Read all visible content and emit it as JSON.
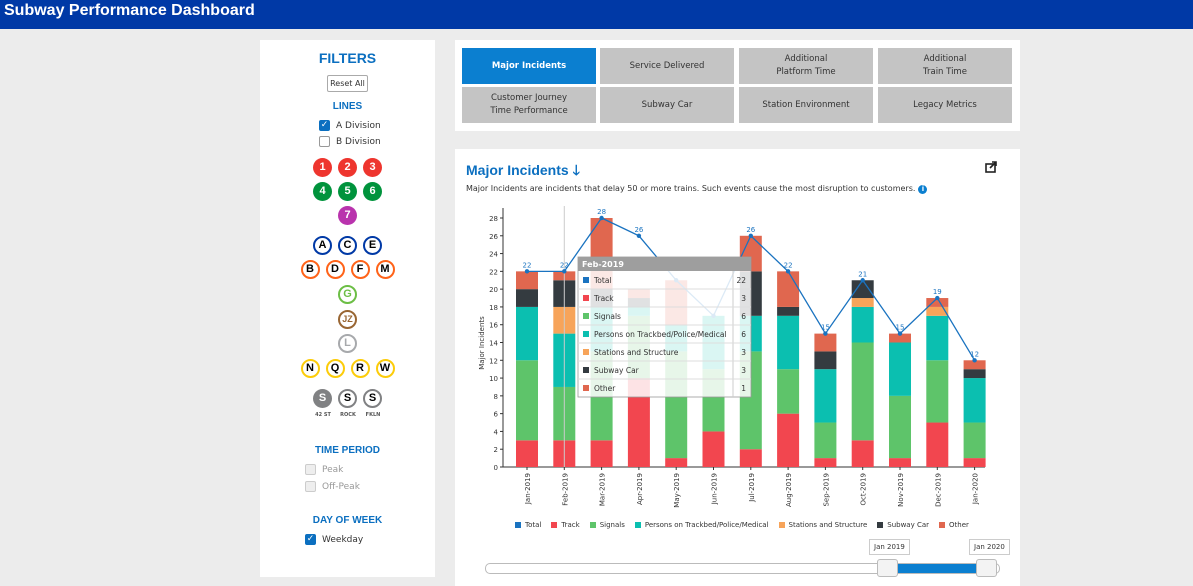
{
  "app": {
    "title": "Subway Performance Dashboard"
  },
  "filters": {
    "title": "FILTERS",
    "reset_label": "Reset All",
    "lines_title": "LINES",
    "divisions": [
      {
        "label": "A Division",
        "checked": true
      },
      {
        "label": "B Division",
        "checked": false
      }
    ],
    "routes": [
      {
        "label": "1",
        "color": "#ee352e",
        "style": "fill"
      },
      {
        "label": "2",
        "color": "#ee352e",
        "style": "fill"
      },
      {
        "label": "3",
        "color": "#ee352e",
        "style": "fill"
      },
      {
        "label": "4",
        "color": "#00933c",
        "style": "fill"
      },
      {
        "label": "5",
        "color": "#00933c",
        "style": "fill"
      },
      {
        "label": "6",
        "color": "#00933c",
        "style": "fill"
      },
      {
        "label": "7",
        "color": "#b933ad",
        "style": "fill"
      },
      {
        "label": "A",
        "color": "#0039a6",
        "style": "ring"
      },
      {
        "label": "C",
        "color": "#0039a6",
        "style": "ring"
      },
      {
        "label": "E",
        "color": "#0039a6",
        "style": "ring"
      },
      {
        "label": "B",
        "color": "#ff6319",
        "style": "ring"
      },
      {
        "label": "D",
        "color": "#ff6319",
        "style": "ring"
      },
      {
        "label": "F",
        "color": "#ff6319",
        "style": "ring"
      },
      {
        "label": "M",
        "color": "#ff6319",
        "style": "ring"
      },
      {
        "label": "G",
        "color": "#6cbe45",
        "style": "ring"
      },
      {
        "label": "JZ",
        "color": "#996633",
        "style": "ring"
      },
      {
        "label": "L",
        "color": "#a7a9ac",
        "style": "ring"
      },
      {
        "label": "N",
        "color": "#fccc0a",
        "style": "ring"
      },
      {
        "label": "Q",
        "color": "#fccc0a",
        "style": "ring"
      },
      {
        "label": "R",
        "color": "#fccc0a",
        "style": "ring"
      },
      {
        "label": "W",
        "color": "#fccc0a",
        "style": "ring"
      },
      {
        "label": "S",
        "color": "#808183",
        "style": "fill",
        "sub": "42 ST"
      },
      {
        "label": "S",
        "color": "#808183",
        "style": "ring",
        "sub": "ROCK"
      },
      {
        "label": "S",
        "color": "#808183",
        "style": "ring",
        "sub": "FKLN"
      }
    ],
    "time_period_title": "TIME PERIOD",
    "time_periods": [
      {
        "label": "Peak"
      },
      {
        "label": "Off-Peak"
      }
    ],
    "day_of_week_title": "DAY OF WEEK",
    "days": [
      {
        "label": "Weekday",
        "checked": true
      }
    ]
  },
  "tabs": [
    {
      "label": "Major Incidents",
      "active": true
    },
    {
      "label": "Service Delivered"
    },
    {
      "label": "Additional\nPlatform Time"
    },
    {
      "label": "Additional\nTrain Time"
    },
    {
      "label": "Customer Journey\nTime Performance"
    },
    {
      "label": "Subway Car"
    },
    {
      "label": "Station Environment"
    },
    {
      "label": "Legacy Metrics"
    }
  ],
  "panel": {
    "title": "Major Incidents",
    "title_arrow": "🡓",
    "description": "Major Incidents are incidents that delay 50 or more trains. Such events cause the most disruption to customers.",
    "info_icon": "i",
    "share_icon": "share-icon"
  },
  "chart_data": {
    "type": "bar",
    "stacked": true,
    "categories": [
      "Jan-2019",
      "Feb-2019",
      "Mar-2019",
      "Apr-2019",
      "May-2019",
      "Jun-2019",
      "Jul-2019",
      "Aug-2019",
      "Sep-2019",
      "Oct-2019",
      "Nov-2019",
      "Dec-2019",
      "Jan-2020"
    ],
    "ylabel": "Major Incidents",
    "ylim": [
      0,
      28
    ],
    "yticks": [
      0,
      2,
      4,
      6,
      8,
      10,
      12,
      14,
      16,
      18,
      20,
      22,
      24,
      26,
      28
    ],
    "series": [
      {
        "name": "Track",
        "color": "#f2464f",
        "values": [
          3,
          3,
          3,
          10,
          1,
          4,
          2,
          6,
          1,
          3,
          1,
          5,
          1
        ]
      },
      {
        "name": "Signals",
        "color": "#5ec46a",
        "values": [
          9,
          6,
          10,
          7,
          12,
          7,
          11,
          5,
          4,
          11,
          7,
          7,
          4
        ]
      },
      {
        "name": "Persons on Trackbed/Police/Medical",
        "color": "#0bbfb0",
        "values": [
          6,
          6,
          5,
          1,
          3,
          6,
          4,
          6,
          6,
          4,
          6,
          5,
          5
        ]
      },
      {
        "name": "Stations and Structure",
        "color": "#f7a45a",
        "values": [
          0,
          3,
          0,
          0,
          0,
          0,
          0,
          0,
          0,
          1,
          0,
          1,
          0
        ]
      },
      {
        "name": "Subway Car",
        "color": "#343b40",
        "values": [
          2,
          3,
          2,
          1,
          0,
          0,
          5,
          1,
          2,
          2,
          0,
          0,
          1
        ]
      },
      {
        "name": "Other",
        "color": "#e0674f",
        "values": [
          2,
          1,
          8,
          1,
          5,
          0,
          4,
          4,
          2,
          0,
          1,
          1,
          1
        ]
      }
    ],
    "total": {
      "name": "Total",
      "color": "#1a73c0",
      "values": [
        22,
        22,
        28,
        26,
        21,
        17,
        26,
        22,
        15,
        21,
        15,
        19,
        12
      ]
    },
    "legend": [
      "Total",
      "Track",
      "Signals",
      "Persons on Trackbed/Police/Medical",
      "Stations and Structure",
      "Subway Car",
      "Other"
    ],
    "legend_position": "bottom",
    "total_labels_shown": [
      22,
      22,
      28,
      26,
      null,
      null,
      26,
      22,
      15,
      21,
      15,
      19,
      12
    ],
    "tooltip": {
      "title": "Feb-2019",
      "rows": [
        {
          "label": "Total",
          "value": 22,
          "color": "#1a73c0"
        },
        {
          "label": "Track",
          "value": 3,
          "color": "#f2464f"
        },
        {
          "label": "Signals",
          "value": 6,
          "color": "#5ec46a"
        },
        {
          "label": "Persons on Trackbed/Police/Medical",
          "value": 6,
          "color": "#0bbfb0"
        },
        {
          "label": "Stations and Structure",
          "value": 3,
          "color": "#f7a45a"
        },
        {
          "label": "Subway Car",
          "value": 3,
          "color": "#343b40"
        },
        {
          "label": "Other",
          "value": 1,
          "color": "#e0674f"
        }
      ]
    },
    "range": {
      "start": "Jan 2019",
      "end": "Jan 2020"
    }
  }
}
